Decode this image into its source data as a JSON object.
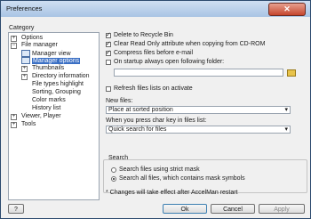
{
  "window": {
    "title": "Preferences",
    "close_glyph": "✕"
  },
  "category": {
    "label": "Category",
    "tree": [
      {
        "label": "Options",
        "expander": "plus"
      },
      {
        "label": "File manager",
        "expander": "minus"
      },
      {
        "label": "Manager view",
        "icon": "window-icon"
      },
      {
        "label": "Manager options",
        "icon": "window-icon",
        "selected": true
      },
      {
        "label": "Thumbnails",
        "expander": "plus"
      },
      {
        "label": "Directory information",
        "expander": "plus"
      },
      {
        "label": "File types highlight"
      },
      {
        "label": "Sorting, Grouping"
      },
      {
        "label": "Color marks"
      },
      {
        "label": "History list"
      },
      {
        "label": "Viewer, Player",
        "expander": "plus"
      },
      {
        "label": "Tools",
        "expander": "plus"
      }
    ]
  },
  "options": {
    "delete_recycle": {
      "label": "Delete to Recycle Bin",
      "checked": true
    },
    "clear_readonly": {
      "label": "Clear Read Only attribute when copying from CD-ROM",
      "checked": true
    },
    "compress_email": {
      "label": "Compress files before e-mail",
      "checked": true
    },
    "startup_folder": {
      "label": "On startup always open following folder:",
      "checked": false,
      "value": ""
    },
    "refresh_activate": {
      "label": "Refresh files lists on activate",
      "checked": false
    }
  },
  "new_files": {
    "label": "New files:",
    "value": "Place at sorted position"
  },
  "char_key": {
    "label": "When you press char key in files list:",
    "value": "Quick search for files"
  },
  "search": {
    "label": "Search",
    "options": [
      {
        "label": "Search files using strict mask",
        "selected": false
      },
      {
        "label": "Search all files, which contains mask symbols",
        "selected": true
      }
    ]
  },
  "note": "* Changes will take effect after AccelMan restart",
  "buttons": {
    "help": "?",
    "ok": "Ok",
    "cancel": "Cancel",
    "apply": "Apply"
  },
  "colors": {
    "selection": "#3a6fc4",
    "close": "#c5452d"
  }
}
